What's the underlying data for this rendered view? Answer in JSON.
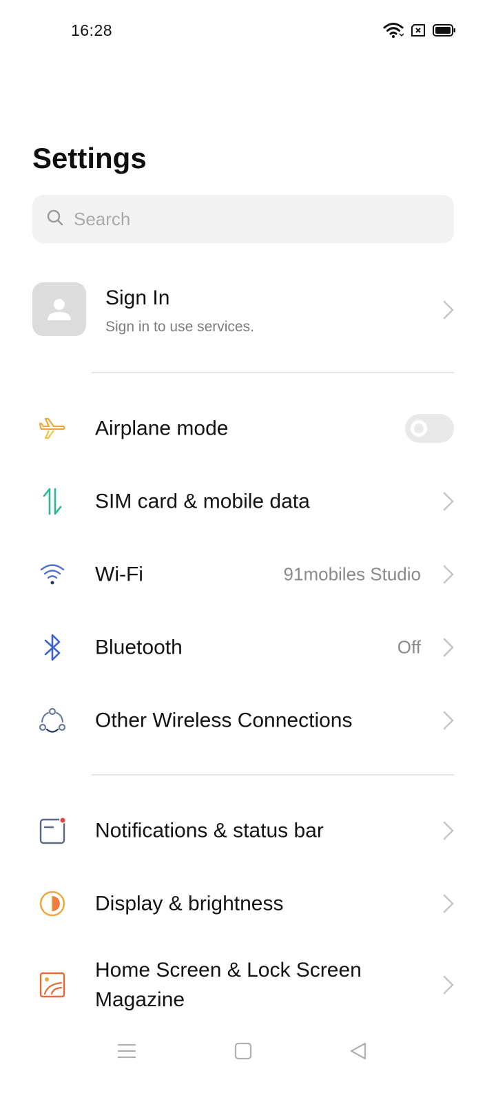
{
  "status_bar": {
    "time": "16:28",
    "icons": [
      "wifi-icon",
      "sim-missing-icon",
      "battery-icon"
    ]
  },
  "header": {
    "title": "Settings"
  },
  "search": {
    "placeholder": "Search"
  },
  "account": {
    "title": "Sign In",
    "subtitle": "Sign in to use services."
  },
  "sections": [
    {
      "items": [
        {
          "label": "Airplane mode",
          "icon": "airplane-icon",
          "control": "toggle",
          "toggle_on": false,
          "color": "#F0A43A"
        },
        {
          "label": "SIM card & mobile data",
          "icon": "mobile-data-icon",
          "control": "chevron",
          "color": "#2FB59C"
        },
        {
          "label": "Wi-Fi",
          "value": "91mobiles Studio",
          "icon": "wifi-icon",
          "control": "chevron",
          "color": "#4F6FD0"
        },
        {
          "label": "Bluetooth",
          "value": "Off",
          "icon": "bluetooth-icon",
          "control": "chevron",
          "color": "#3D63D0"
        },
        {
          "label": "Other Wireless Connections",
          "icon": "wireless-connections-icon",
          "control": "chevron",
          "color": "#6A7A9A"
        }
      ]
    },
    {
      "items": [
        {
          "label": "Notifications & status bar",
          "icon": "notification-icon",
          "control": "chevron",
          "color": "#5A6884"
        },
        {
          "label": "Display & brightness",
          "icon": "brightness-icon",
          "control": "chevron",
          "color": "#F0A43A"
        },
        {
          "label": "Home Screen & Lock Screen Magazine",
          "label_line1": "Home Screen & Lock Screen",
          "label_line2": "Magazine",
          "icon": "wallpaper-icon",
          "control": "chevron",
          "color": "#E46A3A"
        }
      ]
    }
  ],
  "nav_bar": {
    "buttons": [
      "menu-icon",
      "home-icon",
      "back-icon"
    ]
  }
}
